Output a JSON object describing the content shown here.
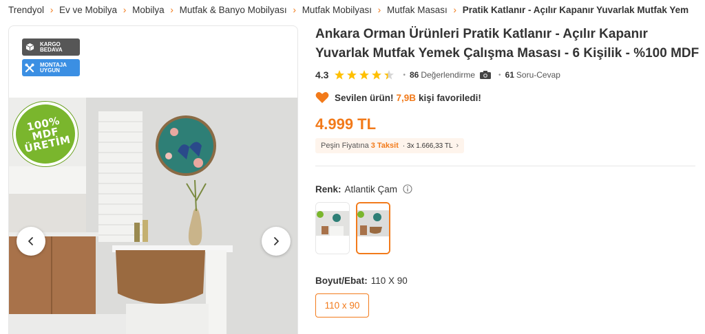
{
  "breadcrumb": [
    "Trendyol",
    "Ev ve Mobilya",
    "Mobilya",
    "Mutfak & Banyo Mobilyası",
    "Mutfak Mobilyası",
    "Mutfak Masası",
    "Pratik Katlanır - Açılır Kapanır Yuvarlak Mutfak Yem"
  ],
  "gallery": {
    "badges": {
      "cargo": {
        "line1": "KARGO",
        "line2": "BEDAVA",
        "icon": "box-icon"
      },
      "montaja": {
        "line1": "MONTAJA",
        "line2": "UYGUN",
        "icon": "tools-icon"
      }
    },
    "stamp": {
      "line1": "100%",
      "line2": "MDF",
      "line3": "ÜRETİM"
    }
  },
  "product": {
    "brand": "Ankara Orman Ürünleri",
    "name": "Pratik Katlanır - Açılır Kapanır Yuvarlak Mutfak Yemek Çalışma Masası - 6 Kişilik - %100 MDF",
    "rating": "4.3",
    "rating_value": 4.3,
    "review_count": "86",
    "review_label": "Değerlendirme",
    "qa_count": "61",
    "qa_label": "Soru-Cevap",
    "favorite": {
      "label": "Sevilen ürün!",
      "count": "7,9B",
      "suffix": "kişi favoriledi!"
    },
    "price": "4.999 TL",
    "installment": {
      "prefix": "Peşin Fiyatına",
      "count": "3 Taksit",
      "detail": "· 3x 1.666,33 TL"
    }
  },
  "color": {
    "label": "Renk:",
    "value": "Atlantik Çam"
  },
  "size": {
    "label": "Boyut/Ebat:",
    "value": "110 X 90",
    "option": "110 x 90"
  },
  "colors": {
    "accent": "#f27a1a",
    "star": "#ffc000",
    "badge_dark": "#565656",
    "badge_blue": "#3b8fe3",
    "stamp_green": "#7ab62d"
  }
}
